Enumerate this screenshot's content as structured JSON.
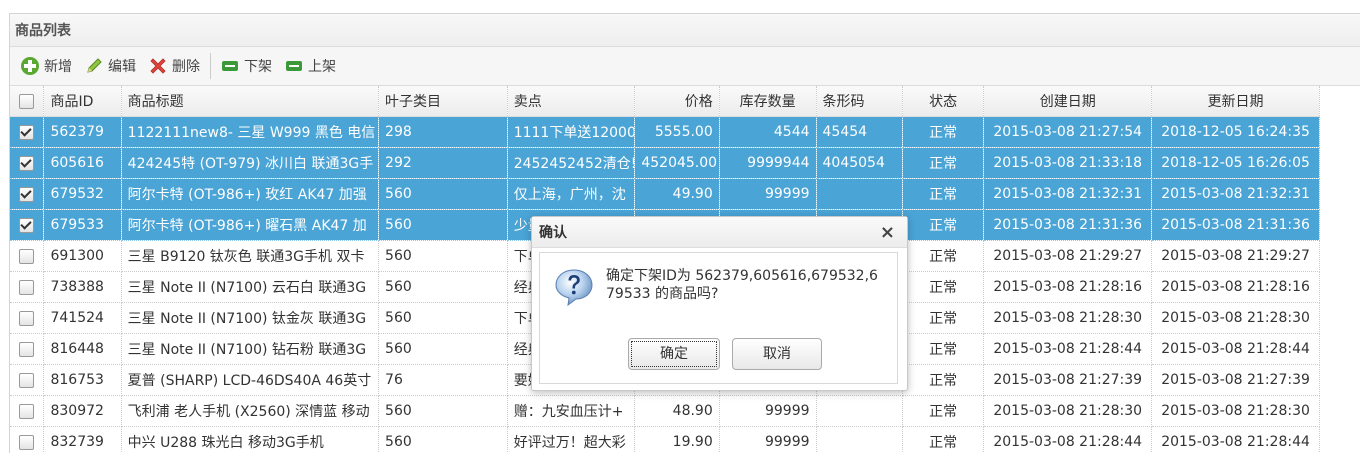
{
  "panel": {
    "title": "商品列表"
  },
  "toolbar": {
    "add": "新增",
    "edit": "编辑",
    "delete": "删除",
    "offshelf": "下架",
    "onshelf": "上架"
  },
  "columns": {
    "id": "商品ID",
    "title": "商品标题",
    "category": "叶子类目",
    "selling_point": "卖点",
    "price": "价格",
    "stock": "库存数量",
    "barcode": "条形码",
    "status": "状态",
    "created": "创建日期",
    "updated": "更新日期"
  },
  "rows": [
    {
      "selected": true,
      "id": "562379",
      "title": "1122111new8- 三星 W999 黑色 电信",
      "category": "298",
      "selling_point": "1111下单送12000",
      "price": "5555.00",
      "stock": "4544",
      "barcode": "45454",
      "status": "正常",
      "created": "2015-03-08 21:27:54",
      "updated": "2018-12-05 16:24:35"
    },
    {
      "selected": true,
      "id": "605616",
      "title": "424245特 (OT-979) 冰川白 联通3G手",
      "category": "292",
      "selling_point": "2452452452清仓!",
      "price": "452045.00",
      "stock": "9999944",
      "barcode": "4045054",
      "status": "正常",
      "created": "2015-03-08 21:33:18",
      "updated": "2018-12-05 16:26:05"
    },
    {
      "selected": true,
      "id": "679532",
      "title": "阿尔卡特 (OT-986+) 玫红 AK47 加强",
      "category": "560",
      "selling_point": "仅上海，广州，沈",
      "price": "49.90",
      "stock": "99999",
      "barcode": "",
      "status": "正常",
      "created": "2015-03-08 21:32:31",
      "updated": "2015-03-08 21:32:31"
    },
    {
      "selected": true,
      "id": "679533",
      "title": "阿尔卡特 (OT-986+) 曜石黑 AK47 加",
      "category": "560",
      "selling_point": "少量",
      "price": "",
      "stock": "",
      "barcode": "",
      "status": "正常",
      "created": "2015-03-08 21:31:36",
      "updated": "2015-03-08 21:31:36"
    },
    {
      "selected": false,
      "id": "691300",
      "title": "三星 B9120 钛灰色 联通3G手机 双卡",
      "category": "560",
      "selling_point": "下单",
      "price": "",
      "stock": "",
      "barcode": "",
      "status": "正常",
      "created": "2015-03-08 21:29:27",
      "updated": "2015-03-08 21:29:27"
    },
    {
      "selected": false,
      "id": "738388",
      "title": "三星 Note II (N7100) 云石白 联通3G",
      "category": "560",
      "selling_point": "经典",
      "price": "",
      "stock": "",
      "barcode": "",
      "status": "正常",
      "created": "2015-03-08 21:28:16",
      "updated": "2015-03-08 21:28:16"
    },
    {
      "selected": false,
      "id": "741524",
      "title": "三星 Note II (N7100) 钛金灰 联通3G",
      "category": "560",
      "selling_point": "下单",
      "price": "",
      "stock": "",
      "barcode": "",
      "status": "正常",
      "created": "2015-03-08 21:28:30",
      "updated": "2015-03-08 21:28:30"
    },
    {
      "selected": false,
      "id": "816448",
      "title": "三星 Note II (N7100) 钻石粉 联通3G",
      "category": "560",
      "selling_point": "经典",
      "price": "",
      "stock": "",
      "barcode": "",
      "status": "正常",
      "created": "2015-03-08 21:28:44",
      "updated": "2015-03-08 21:28:44"
    },
    {
      "selected": false,
      "id": "816753",
      "title": "夏普 (SHARP) LCD-46DS40A 46英寸",
      "category": "76",
      "selling_point": "要好",
      "price": "",
      "stock": "",
      "barcode": "",
      "status": "正常",
      "created": "2015-03-08 21:27:39",
      "updated": "2015-03-08 21:27:39"
    },
    {
      "selected": false,
      "id": "830972",
      "title": "飞利浦 老人手机 (X2560) 深情蓝 移动",
      "category": "560",
      "selling_point": "赠：九安血压计+",
      "price": "48.90",
      "stock": "99999",
      "barcode": "",
      "status": "正常",
      "created": "2015-03-08 21:28:30",
      "updated": "2015-03-08 21:28:30"
    },
    {
      "selected": false,
      "id": "832739",
      "title": "中兴 U288 珠光白 移动3G手机",
      "category": "560",
      "selling_point": "好评过万！超大彩",
      "price": "19.90",
      "stock": "99999",
      "barcode": "",
      "status": "正常",
      "created": "2015-03-08 21:28:44",
      "updated": "2015-03-08 21:28:44"
    }
  ],
  "dialog": {
    "title": "确认",
    "close": "×",
    "message": "确定下架ID为 562379,605616,679532,679533 的商品吗?",
    "ok": "确定",
    "cancel": "取消"
  },
  "colors": {
    "selected_row": "#4aa4d6"
  }
}
